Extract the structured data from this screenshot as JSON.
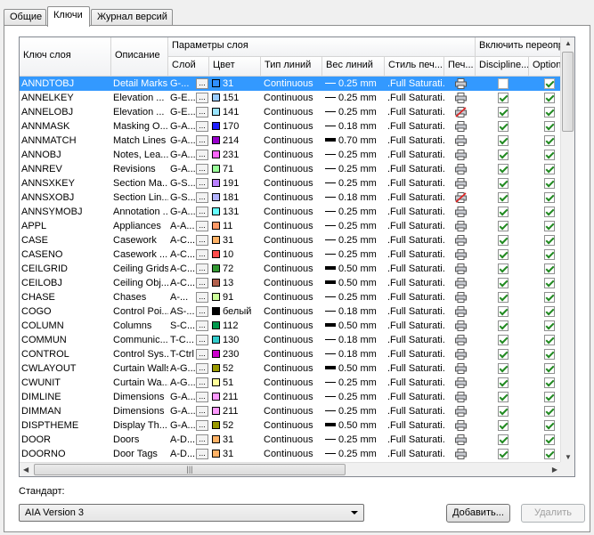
{
  "tabs": [
    "Общие",
    "Ключи",
    "Журнал версий"
  ],
  "active_tab": 1,
  "grid": {
    "headers": {
      "key": "Ключ слоя",
      "desc": "Описание",
      "params_group": "Параметры слоя",
      "layer": "Слой",
      "color": "Цвет",
      "linetype": "Тип линий",
      "lineweight": "Вес линий",
      "plotstyle": "Стиль печ...",
      "plot": "Печ...",
      "override_group": "Включить переопре",
      "discipline": "Discipline...",
      "optional": "Optional"
    },
    "rows": [
      {
        "key": "ANNDTOBJ",
        "desc": "Detail Marks",
        "layer": "G-...",
        "color_hex": "#2f8fff",
        "color": "31",
        "ltype": "Continuous",
        "lw": "0.25 mm",
        "thick": false,
        "style": ".Full Saturati...",
        "plot": true,
        "disc": false,
        "opt": true
      },
      {
        "key": "ANNELKEY",
        "desc": "Elevation ...",
        "layer": "G-E...",
        "color_hex": "#99ccff",
        "color": "151",
        "ltype": "Continuous",
        "lw": "0.25 mm",
        "thick": false,
        "style": ".Full Saturati...",
        "plot": true,
        "disc": true,
        "opt": true
      },
      {
        "key": "ANNELOBJ",
        "desc": "Elevation ...",
        "layer": "G-E...",
        "color_hex": "#99e5ff",
        "color": "141",
        "ltype": "Continuous",
        "lw": "0.25 mm",
        "thick": false,
        "style": ".Full Saturati...",
        "plot": false,
        "disc": true,
        "opt": true
      },
      {
        "key": "ANNMASK",
        "desc": "Masking O...",
        "layer": "G-A...",
        "color_hex": "#1f1fff",
        "color": "170",
        "ltype": "Continuous",
        "lw": "0.18 mm",
        "thick": false,
        "style": ".Full Saturati...",
        "plot": true,
        "disc": true,
        "opt": true
      },
      {
        "key": "ANNMATCH",
        "desc": "Match Lines",
        "layer": "G-A...",
        "color_hex": "#9900cc",
        "color": "214",
        "ltype": "Continuous",
        "lw": "0.70 mm",
        "thick": true,
        "style": ".Full Saturati...",
        "plot": true,
        "disc": true,
        "opt": true
      },
      {
        "key": "ANNOBJ",
        "desc": "Notes, Lea...",
        "layer": "G-A...",
        "color_hex": "#ff66ff",
        "color": "231",
        "ltype": "Continuous",
        "lw": "0.25 mm",
        "thick": false,
        "style": ".Full Saturati...",
        "plot": true,
        "disc": true,
        "opt": true
      },
      {
        "key": "ANNREV",
        "desc": "Revisions",
        "layer": "G-A...",
        "color_hex": "#99ff99",
        "color": "71",
        "ltype": "Continuous",
        "lw": "0.25 mm",
        "thick": false,
        "style": ".Full Saturati...",
        "plot": true,
        "disc": true,
        "opt": true
      },
      {
        "key": "ANNSXKEY",
        "desc": "Section Ma...",
        "layer": "G-S...",
        "color_hex": "#b97fff",
        "color": "191",
        "ltype": "Continuous",
        "lw": "0.25 mm",
        "thick": false,
        "style": ".Full Saturati...",
        "plot": true,
        "disc": true,
        "opt": true
      },
      {
        "key": "ANNSXOBJ",
        "desc": "Section Lin...",
        "layer": "G-S...",
        "color_hex": "#b2b2ff",
        "color": "181",
        "ltype": "Continuous",
        "lw": "0.18 mm",
        "thick": false,
        "style": ".Full Saturati...",
        "plot": false,
        "disc": true,
        "opt": true
      },
      {
        "key": "ANNSYMOBJ",
        "desc": "Annotation ...",
        "layer": "G-A...",
        "color_hex": "#66ffff",
        "color": "131",
        "ltype": "Continuous",
        "lw": "0.25 mm",
        "thick": false,
        "style": ".Full Saturati...",
        "plot": true,
        "disc": true,
        "opt": true
      },
      {
        "key": "APPL",
        "desc": "Appliances",
        "layer": "A-A...",
        "color_hex": "#ff9966",
        "color": "11",
        "ltype": "Continuous",
        "lw": "0.25 mm",
        "thick": false,
        "style": ".Full Saturati...",
        "plot": true,
        "disc": true,
        "opt": true
      },
      {
        "key": "CASE",
        "desc": "Casework",
        "layer": "A-C...",
        "color_hex": "#ffb266",
        "color": "31",
        "ltype": "Continuous",
        "lw": "0.25 mm",
        "thick": false,
        "style": ".Full Saturati...",
        "plot": true,
        "disc": true,
        "opt": true
      },
      {
        "key": "CASENO",
        "desc": "Casework ...",
        "layer": "A-C...",
        "color_hex": "#ff4c4c",
        "color": "10",
        "ltype": "Continuous",
        "lw": "0.25 mm",
        "thick": false,
        "style": ".Full Saturati...",
        "plot": true,
        "disc": true,
        "opt": true
      },
      {
        "key": "CEILGRID",
        "desc": "Ceiling Grids",
        "layer": "A-C...",
        "color_hex": "#339933",
        "color": "72",
        "ltype": "Continuous",
        "lw": "0.50 mm",
        "thick": true,
        "style": ".Full Saturati...",
        "plot": true,
        "disc": true,
        "opt": true
      },
      {
        "key": "CEILOBJ",
        "desc": "Ceiling Obj...",
        "layer": "A-C...",
        "color_hex": "#b2604c",
        "color": "13",
        "ltype": "Continuous",
        "lw": "0.50 mm",
        "thick": true,
        "style": ".Full Saturati...",
        "plot": true,
        "disc": true,
        "opt": true
      },
      {
        "key": "CHASE",
        "desc": "Chases",
        "layer": "A-...",
        "color_hex": "#ccff99",
        "color": "91",
        "ltype": "Continuous",
        "lw": "0.25 mm",
        "thick": false,
        "style": ".Full Saturati...",
        "plot": true,
        "disc": true,
        "opt": true
      },
      {
        "key": "COGO",
        "desc": "Control Poi...",
        "layer": "AS-...",
        "color_hex": "#000000",
        "color": "белый",
        "ltype": "Continuous",
        "lw": "0.18 mm",
        "thick": false,
        "style": ".Full Saturati...",
        "plot": true,
        "disc": true,
        "opt": true
      },
      {
        "key": "COLUMN",
        "desc": "Columns",
        "layer": "S-C...",
        "color_hex": "#00994c",
        "color": "112",
        "ltype": "Continuous",
        "lw": "0.50 mm",
        "thick": true,
        "style": ".Full Saturati...",
        "plot": true,
        "disc": true,
        "opt": true
      },
      {
        "key": "COMMUN",
        "desc": "Communic...",
        "layer": "T-C...",
        "color_hex": "#33cccc",
        "color": "130",
        "ltype": "Continuous",
        "lw": "0.18 mm",
        "thick": false,
        "style": ".Full Saturati...",
        "plot": true,
        "disc": true,
        "opt": true
      },
      {
        "key": "CONTROL",
        "desc": "Control Sys...",
        "layer": "T-Ctrl",
        "color_hex": "#cc00cc",
        "color": "230",
        "ltype": "Continuous",
        "lw": "0.18 mm",
        "thick": false,
        "style": ".Full Saturati...",
        "plot": true,
        "disc": true,
        "opt": true
      },
      {
        "key": "CWLAYOUT",
        "desc": "Curtain Walls",
        "layer": "A-G...",
        "color_hex": "#999900",
        "color": "52",
        "ltype": "Continuous",
        "lw": "0.50 mm",
        "thick": true,
        "style": ".Full Saturati...",
        "plot": true,
        "disc": true,
        "opt": true
      },
      {
        "key": "CWUNIT",
        "desc": "Curtain Wa...",
        "layer": "A-G...",
        "color_hex": "#ffff99",
        "color": "51",
        "ltype": "Continuous",
        "lw": "0.25 mm",
        "thick": false,
        "style": ".Full Saturati...",
        "plot": true,
        "disc": true,
        "opt": true
      },
      {
        "key": "DIMLINE",
        "desc": "Dimensions",
        "layer": "G-A...",
        "color_hex": "#ff99ff",
        "color": "211",
        "ltype": "Continuous",
        "lw": "0.25 mm",
        "thick": false,
        "style": ".Full Saturati...",
        "plot": true,
        "disc": true,
        "opt": true
      },
      {
        "key": "DIMMAN",
        "desc": "Dimensions",
        "layer": "G-A...",
        "color_hex": "#ff99ff",
        "color": "211",
        "ltype": "Continuous",
        "lw": "0.25 mm",
        "thick": false,
        "style": ".Full Saturati...",
        "plot": true,
        "disc": true,
        "opt": true
      },
      {
        "key": "DISPTHEME",
        "desc": "Display Th...",
        "layer": "G-A...",
        "color_hex": "#999900",
        "color": "52",
        "ltype": "Continuous",
        "lw": "0.50 mm",
        "thick": true,
        "style": ".Full Saturati...",
        "plot": true,
        "disc": true,
        "opt": true
      },
      {
        "key": "DOOR",
        "desc": "Doors",
        "layer": "A-D...",
        "color_hex": "#ffb266",
        "color": "31",
        "ltype": "Continuous",
        "lw": "0.25 mm",
        "thick": false,
        "style": ".Full Saturati...",
        "plot": true,
        "disc": true,
        "opt": true
      },
      {
        "key": "DOORNO",
        "desc": "Door Tags",
        "layer": "A-D...",
        "color_hex": "#ffb266",
        "color": "31",
        "ltype": "Continuous",
        "lw": "0.25 mm",
        "thick": false,
        "style": ".Full Saturati...",
        "plot": true,
        "disc": true,
        "opt": true
      }
    ]
  },
  "standard_label": "Стандарт:",
  "standard_value": "AIA Version 3",
  "add_button": "Добавить...",
  "delete_button": "Удалить"
}
